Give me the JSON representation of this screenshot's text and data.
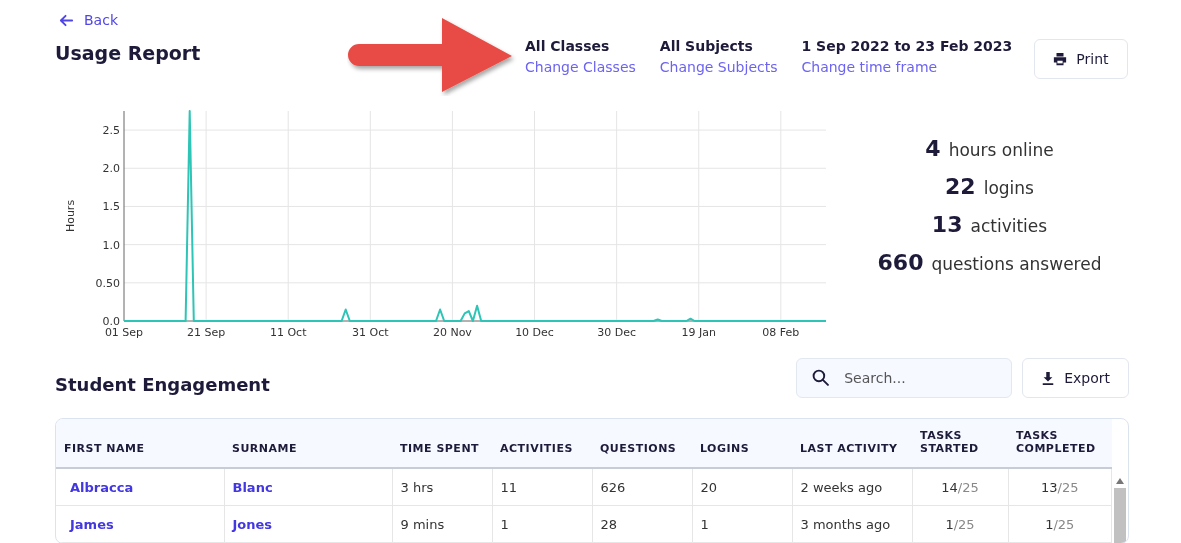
{
  "back_link": {
    "label": "Back"
  },
  "title": "Usage Report",
  "filters": [
    {
      "value": "All Classes",
      "link": "Change Classes"
    },
    {
      "value": "All Subjects",
      "link": "Change Subjects"
    },
    {
      "value": "1 Sep 2022 to 23 Feb 2023",
      "link": "Change time frame"
    }
  ],
  "print_button": {
    "label": "Print"
  },
  "usage_chart": {
    "chart_data": {
      "type": "line",
      "ylabel": "Hours",
      "categories": [
        "01 Sep",
        null,
        null,
        null,
        null,
        null,
        null,
        null,
        null,
        null,
        null,
        null,
        null,
        null,
        null,
        null,
        null,
        null,
        null,
        null,
        "21 Sep",
        null,
        null,
        null,
        null,
        null,
        null,
        null,
        null,
        null,
        null,
        null,
        null,
        null,
        null,
        null,
        null,
        null,
        null,
        null,
        "11 Oct",
        null,
        null,
        null,
        null,
        null,
        null,
        null,
        null,
        null,
        null,
        null,
        null,
        null,
        null,
        null,
        null,
        null,
        null,
        null,
        "31 Oct",
        null,
        null,
        null,
        null,
        null,
        null,
        null,
        null,
        null,
        null,
        null,
        null,
        null,
        null,
        null,
        null,
        null,
        null,
        null,
        "20 Nov",
        null,
        null,
        null,
        null,
        null,
        null,
        null,
        null,
        null,
        null,
        null,
        null,
        null,
        null,
        null,
        null,
        null,
        null,
        null,
        "10 Dec",
        null,
        null,
        null,
        null,
        null,
        null,
        null,
        null,
        null,
        null,
        null,
        null,
        null,
        null,
        null,
        null,
        null,
        null,
        null,
        "30 Dec",
        null,
        null,
        null,
        null,
        null,
        null,
        null,
        null,
        null,
        null,
        null,
        null,
        null,
        null,
        null,
        null,
        null,
        null,
        null,
        "19 Jan",
        null,
        null,
        null,
        null,
        null,
        null,
        null,
        null,
        null,
        null,
        null,
        null,
        null,
        null,
        null,
        null,
        null,
        null,
        null,
        "08 Feb",
        null,
        null,
        null,
        null,
        null,
        null,
        null,
        null,
        null,
        null,
        null
      ],
      "series": [
        {
          "color": "#2ec4b6",
          "values": [
            0,
            0,
            0,
            0,
            0,
            0,
            0,
            0,
            0,
            0,
            0,
            0,
            0,
            0,
            0,
            0,
            2.75,
            0,
            0,
            0,
            0,
            0,
            0,
            0,
            0,
            0,
            0,
            0,
            0,
            0,
            0,
            0,
            0,
            0,
            0,
            0,
            0,
            0,
            0,
            0,
            0,
            0,
            0,
            0,
            0,
            0,
            0,
            0,
            0,
            0,
            0,
            0,
            0,
            0,
            0.15,
            0,
            0,
            0,
            0,
            0,
            0,
            0,
            0,
            0,
            0,
            0,
            0,
            0,
            0,
            0,
            0,
            0,
            0,
            0,
            0,
            0,
            0,
            0.15,
            0,
            0,
            0,
            0,
            0,
            0.1,
            0.13,
            0,
            0.2,
            0,
            0,
            0,
            0,
            0,
            0,
            0,
            0,
            0,
            0,
            0,
            0,
            0,
            0,
            0,
            0,
            0,
            0,
            0,
            0,
            0,
            0,
            0,
            0,
            0,
            0,
            0,
            0,
            0,
            0,
            0,
            0,
            0,
            0,
            0,
            0,
            0,
            0,
            0,
            0,
            0,
            0,
            0,
            0.02,
            0,
            0,
            0,
            0,
            0,
            0,
            0,
            0.03,
            0,
            0,
            0,
            0,
            0,
            0,
            0,
            0,
            0,
            0,
            0,
            0,
            0,
            0,
            0,
            0,
            0,
            0,
            0,
            0,
            0,
            0,
            0,
            0,
            0,
            0,
            0,
            0,
            0,
            0,
            0,
            0,
            0
          ]
        }
      ],
      "ylim": [
        0,
        2.75
      ],
      "grid": true,
      "yticks": [
        {
          "value": 0,
          "label": "0.0"
        },
        {
          "value": 0.5,
          "label": "0.50"
        },
        {
          "value": 1,
          "label": "1.0"
        },
        {
          "value": 1.5,
          "label": "1.5"
        },
        {
          "value": 2,
          "label": "2.0"
        },
        {
          "value": 2.5,
          "label": "2.5"
        }
      ]
    }
  },
  "stats": [
    {
      "number": "4",
      "label": "hours online"
    },
    {
      "number": "22",
      "label": "logins"
    },
    {
      "number": "13",
      "label": "activities"
    },
    {
      "number": "660",
      "label": "questions answered"
    }
  ],
  "engagement": {
    "title": "Student Engagement",
    "search": {
      "placeholder": "Search..."
    },
    "export_button": {
      "label": "Export"
    },
    "columns": [
      "FIRST NAME",
      "SURNAME",
      "TIME SPENT",
      "ACTIVITIES",
      "QUESTIONS",
      "LOGINS",
      "LAST ACTIVITY",
      "TASKS STARTED",
      "TASKS COMPLETED"
    ],
    "rows": [
      {
        "first_name": "Albracca",
        "surname": "Blanc",
        "time_spent": "3 hrs",
        "activities": "11",
        "questions": "626",
        "logins": "20",
        "last_activity": "2 weeks ago",
        "tasks_started": [
          "14",
          "/25"
        ],
        "tasks_completed": [
          "13",
          "/25"
        ]
      },
      {
        "first_name": "James",
        "surname": "Jones",
        "time_spent": "9 mins",
        "activities": "1",
        "questions": "28",
        "logins": "1",
        "last_activity": "3 months ago",
        "tasks_started": [
          "1",
          "/25"
        ],
        "tasks_completed": [
          "1",
          "/25"
        ]
      }
    ]
  }
}
